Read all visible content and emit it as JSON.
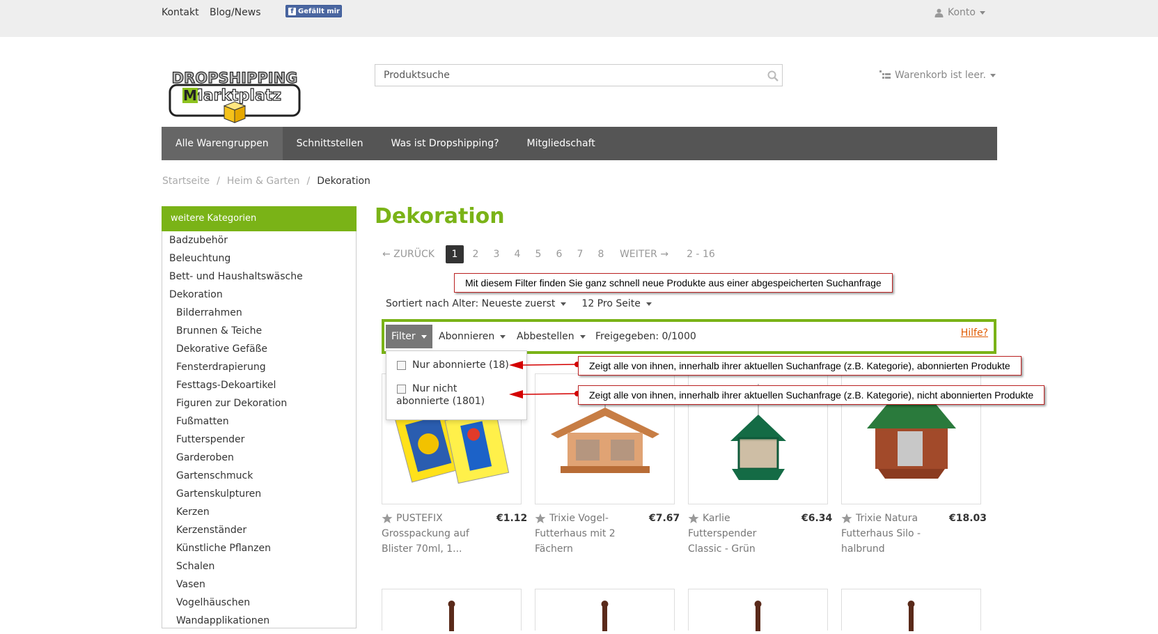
{
  "topbar": {
    "links": [
      "Kontakt",
      "Blog/News"
    ],
    "facebook_like": "Gefällt mir",
    "account": "Konto"
  },
  "logo": {
    "line1": "DROPSHIPPING",
    "line2": "Marktplatz"
  },
  "search": {
    "placeholder": "Produktsuche"
  },
  "cart": {
    "label": "Warenkorb ist leer."
  },
  "nav": {
    "items": [
      "Alle Warengruppen",
      "Schnittstellen",
      "Was ist Dropshipping?",
      "Mitgliedschaft"
    ]
  },
  "breadcrumb": {
    "items": [
      "Startseite",
      "Heim & Garten",
      "Dekoration"
    ],
    "separator": "/"
  },
  "sidebar": {
    "title": "weitere Kategorien",
    "top_categories": [
      "Badzubehör",
      "Beleuchtung",
      "Bett- und Haushaltswäsche",
      "Dekoration"
    ],
    "sub_categories": [
      "Bilderrahmen",
      "Brunnen & Teiche",
      "Dekorative Gefäße",
      "Fensterdrapierung",
      "Festtags-Dekoartikel",
      "Figuren zur Dekoration",
      "Fußmatten",
      "Futterspender",
      "Garderoben",
      "Gartenschmuck",
      "Gartenskulpturen",
      "Kerzen",
      "Kerzenständer",
      "Künstliche Pflanzen",
      "Schalen",
      "Vasen",
      "Vogelhäuschen",
      "Wandapplikationen"
    ]
  },
  "main": {
    "title": "Dekoration",
    "pagination": {
      "prev": "← ZURÜCK",
      "pages": [
        "1",
        "2",
        "3",
        "4",
        "5",
        "6",
        "7",
        "8"
      ],
      "current": "1",
      "next": "WEITER →",
      "range": "2 - 16"
    },
    "sort": {
      "label": "Sortiert nach Alter: Neueste zuerst",
      "per_page": "12 Pro Seite"
    },
    "filterbar": {
      "filter": "Filter",
      "subscribe": "Abonnieren",
      "unsubscribe": "Abbestellen",
      "released": "Freigegeben: 0/1000",
      "help": "Hilfe?"
    },
    "dropdown": {
      "option1": "Nur abonnierte (18)",
      "option2_line1": "Nur nicht",
      "option2_line2": "abonnierte (1801)"
    },
    "annotations": {
      "top": "Mit diesem Filter finden Sie ganz schnell neue Produkte aus einer abgespeicherten Suchanfrage",
      "subscribed": "Zeigt alle von ihnen, innerhalb ihrer aktuellen Suchanfrage (z.B. Kategorie), abonnierten Produkte",
      "not_subscribed": "Zeigt alle von ihnen, innerhalb ihrer aktuellen Suchanfrage (z.B. Kategorie), nicht abonnierten Produkte"
    },
    "products": [
      {
        "name_lines": [
          "PUSTEFIX",
          "Grosspackung auf",
          "Blister 70ml, 1..."
        ],
        "price": "€1.12"
      },
      {
        "name_lines": [
          "Trixie Vogel-",
          "Futterhaus mit 2",
          "Fächern"
        ],
        "price": "€7.67"
      },
      {
        "name_lines": [
          "Karlie",
          "Futterspender",
          "Classic - Grün"
        ],
        "price": "€6.34"
      },
      {
        "name_lines": [
          "Trixie Natura",
          "Futterhaus Silo -",
          "halbrund"
        ],
        "price": "€18.03"
      }
    ]
  },
  "colors": {
    "accent_green": "#7ab317",
    "nav_bg": "#555555",
    "help_link": "#e05a00",
    "callout_border": "#b22222",
    "arrow_red": "#d40000"
  }
}
